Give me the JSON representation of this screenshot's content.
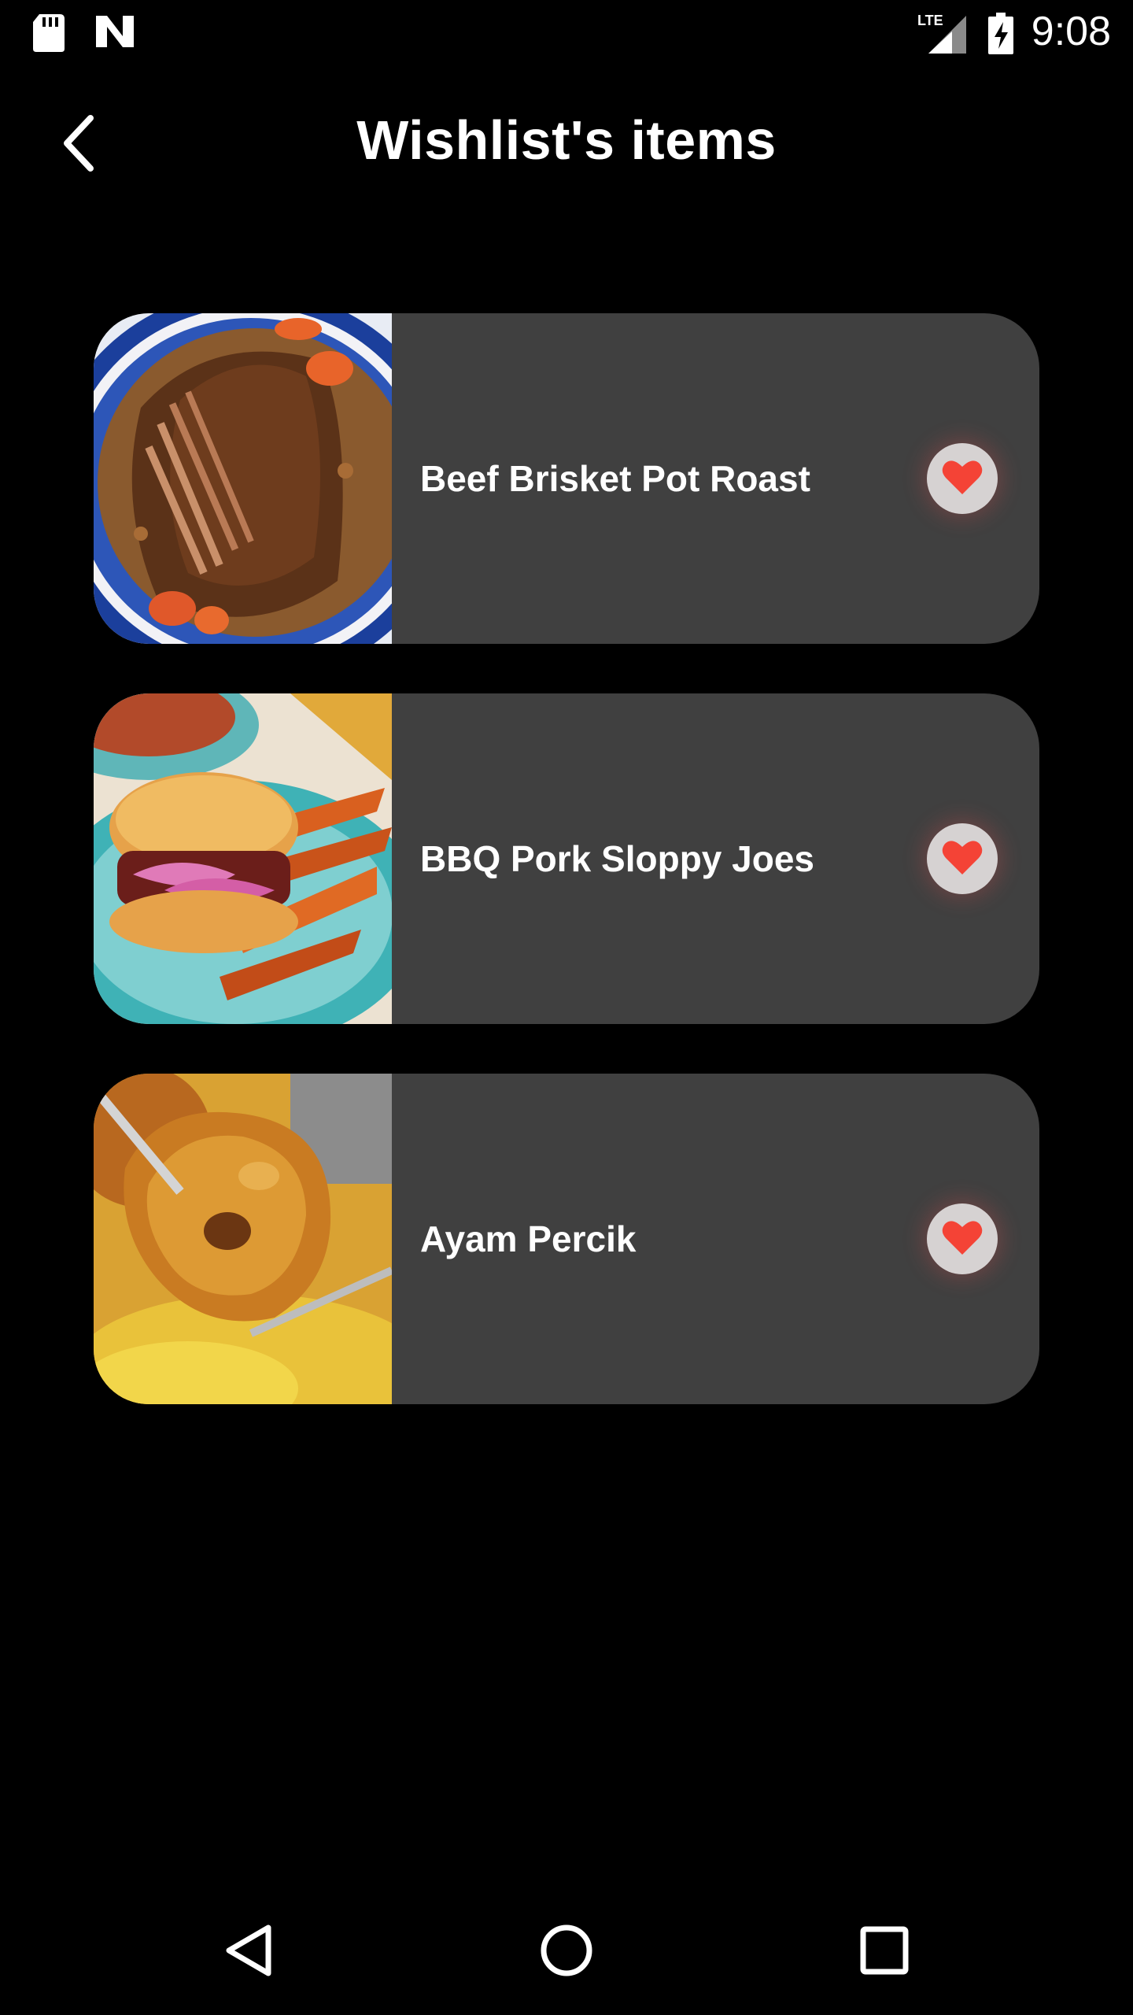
{
  "status_bar": {
    "time": "9:08",
    "network": "LTE",
    "icons": [
      "sd-card-icon",
      "n-notification-icon",
      "lte-signal-icon",
      "battery-charging-icon"
    ]
  },
  "header": {
    "title": "Wishlist's items",
    "back_icon": "back-arrow-icon"
  },
  "wishlist": {
    "items": [
      {
        "name": "Beef Brisket Pot Roast",
        "image": "beef-brisket-pot-roast-photo",
        "favorite": true
      },
      {
        "name": "BBQ Pork Sloppy Joes",
        "image": "bbq-pork-sloppy-joes-photo",
        "favorite": true
      },
      {
        "name": "Ayam Percik",
        "image": "ayam-percik-photo",
        "favorite": true
      }
    ]
  },
  "colors": {
    "background": "#000000",
    "card": "#404040",
    "fav_button": "#d6d2d2",
    "heart": "#f44336",
    "text": "#ffffff"
  },
  "nav_bar": {
    "buttons": [
      "back-triangle-icon",
      "home-circle-icon",
      "recents-square-icon"
    ]
  }
}
